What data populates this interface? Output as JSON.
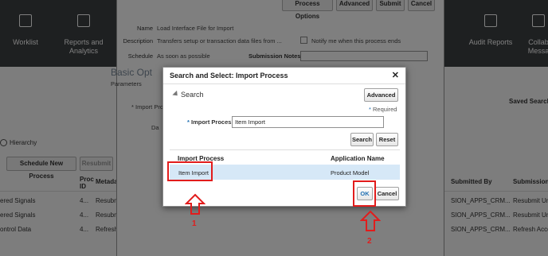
{
  "nav": {
    "worklist": "Worklist",
    "reports": "Reports and Analytics",
    "audit": "Audit Reports",
    "collab": "Collab Messa"
  },
  "bg": {
    "hierarchy": "Hierarchy",
    "schedule_new": "Schedule New Process",
    "resubmit": "Resubmit",
    "saved_search": "Saved Search",
    "col_proc_id": "Proc ID",
    "col_metadata": "Metada",
    "col_submitted_by": "Submitted By",
    "col_submission": "Submission",
    "rows": [
      {
        "name": "ered Signals",
        "id": "4...",
        "meta": "Resubmi",
        "by": "SION_APPS_CRM...",
        "sub": "Resubmit Unde"
      },
      {
        "name": "ered Signals",
        "id": "4...",
        "meta": "Resubmi",
        "by": "SION_APPS_CRM...",
        "sub": "Resubmit Unde"
      },
      {
        "name": "ontrol Data",
        "id": "4...",
        "meta": "Refresh",
        "by": "SION_APPS_CRM...",
        "sub": "Refresh Acces"
      }
    ]
  },
  "process_window": {
    "buttons": {
      "options": "Process Options",
      "advanced": "Advanced",
      "submit": "Submit",
      "cancel": "Cancel"
    },
    "name_label": "Name",
    "name_value": "Load Interface File for Import",
    "desc_label": "Description",
    "desc_value": "Transfers setup or transaction data files from ...",
    "schedule_label": "Schedule",
    "schedule_value": "As soon as possible",
    "notify": "Notify me when this process ends",
    "submission_notes": "Submission Notes",
    "basic_options": "Basic Opt",
    "parameters": "Parameters",
    "import_pro": "* Import Pro",
    "da": "Da"
  },
  "dialog": {
    "title": "Search and Select: Import Process",
    "close": "✕",
    "search_header": "Search",
    "advanced_btn": "Advanced",
    "required_note": "Required",
    "field_label": "Import Process",
    "field_value": "Item Import",
    "search_btn": "Search",
    "reset_btn": "Reset",
    "columns": [
      "Import Process",
      "Application Name"
    ],
    "rows": [
      {
        "process": "Item Import",
        "app": "Product Model"
      }
    ],
    "ok_btn": "OK",
    "cancel_btn": "Cancel"
  },
  "annotations": {
    "step1": "1",
    "step2": "2",
    "color": "#e21c1c"
  }
}
